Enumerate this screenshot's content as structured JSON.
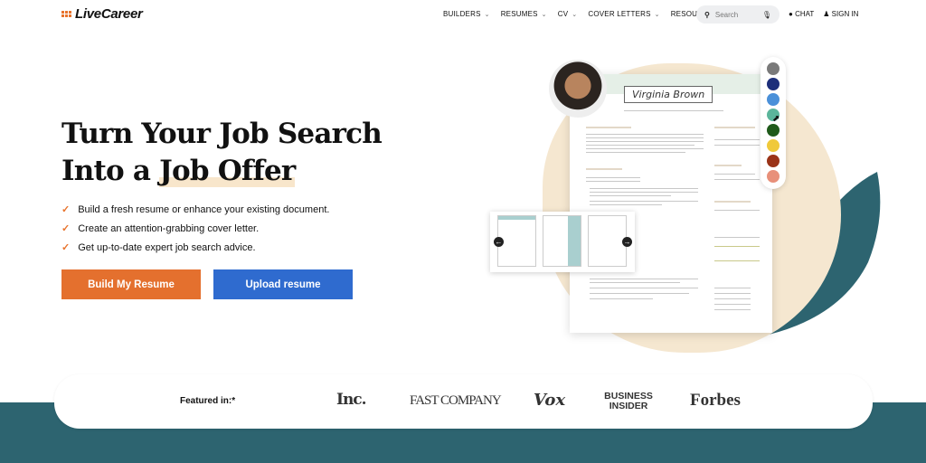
{
  "header": {
    "logo": "LiveCareer",
    "nav": [
      {
        "label": "BUILDERS",
        "dropdown": true
      },
      {
        "label": "RESUMES",
        "dropdown": true
      },
      {
        "label": "CV",
        "dropdown": true
      },
      {
        "label": "COVER LETTERS",
        "dropdown": true
      },
      {
        "label": "RESOURCES",
        "dropdown": false
      }
    ],
    "search_placeholder": "Search",
    "chat": "CHAT",
    "sign_in": "SIGN IN"
  },
  "hero": {
    "title_line1": "Turn Your Job Search",
    "title_line2_prefix": "Into a ",
    "title_line2_highlight": "Job Offer",
    "bullets": [
      "Build a fresh resume or enhance your existing document.",
      "Create an attention-grabbing cover letter.",
      "Get up-to-date expert job search advice."
    ],
    "primary_button": "Build My Resume",
    "secondary_button": "Upload resume"
  },
  "illustration": {
    "resume_name": "Virginia Brown",
    "palette": [
      "#7a7a7a",
      "#1d2f7a",
      "#4a90d9",
      "#5bb59b",
      "#1f5a1a",
      "#f0c93a",
      "#9a3318",
      "#e8907a"
    ],
    "selected_color": "#5bb59b"
  },
  "featured": {
    "label": "Featured in:*",
    "brands": [
      "Inc.",
      "FAST COMPANY",
      "Vox",
      "BUSINESS INSIDER",
      "Forbes"
    ]
  },
  "colors": {
    "accent_orange": "#e4702e",
    "accent_blue": "#2f6bcf",
    "teal": "#2d6470"
  }
}
